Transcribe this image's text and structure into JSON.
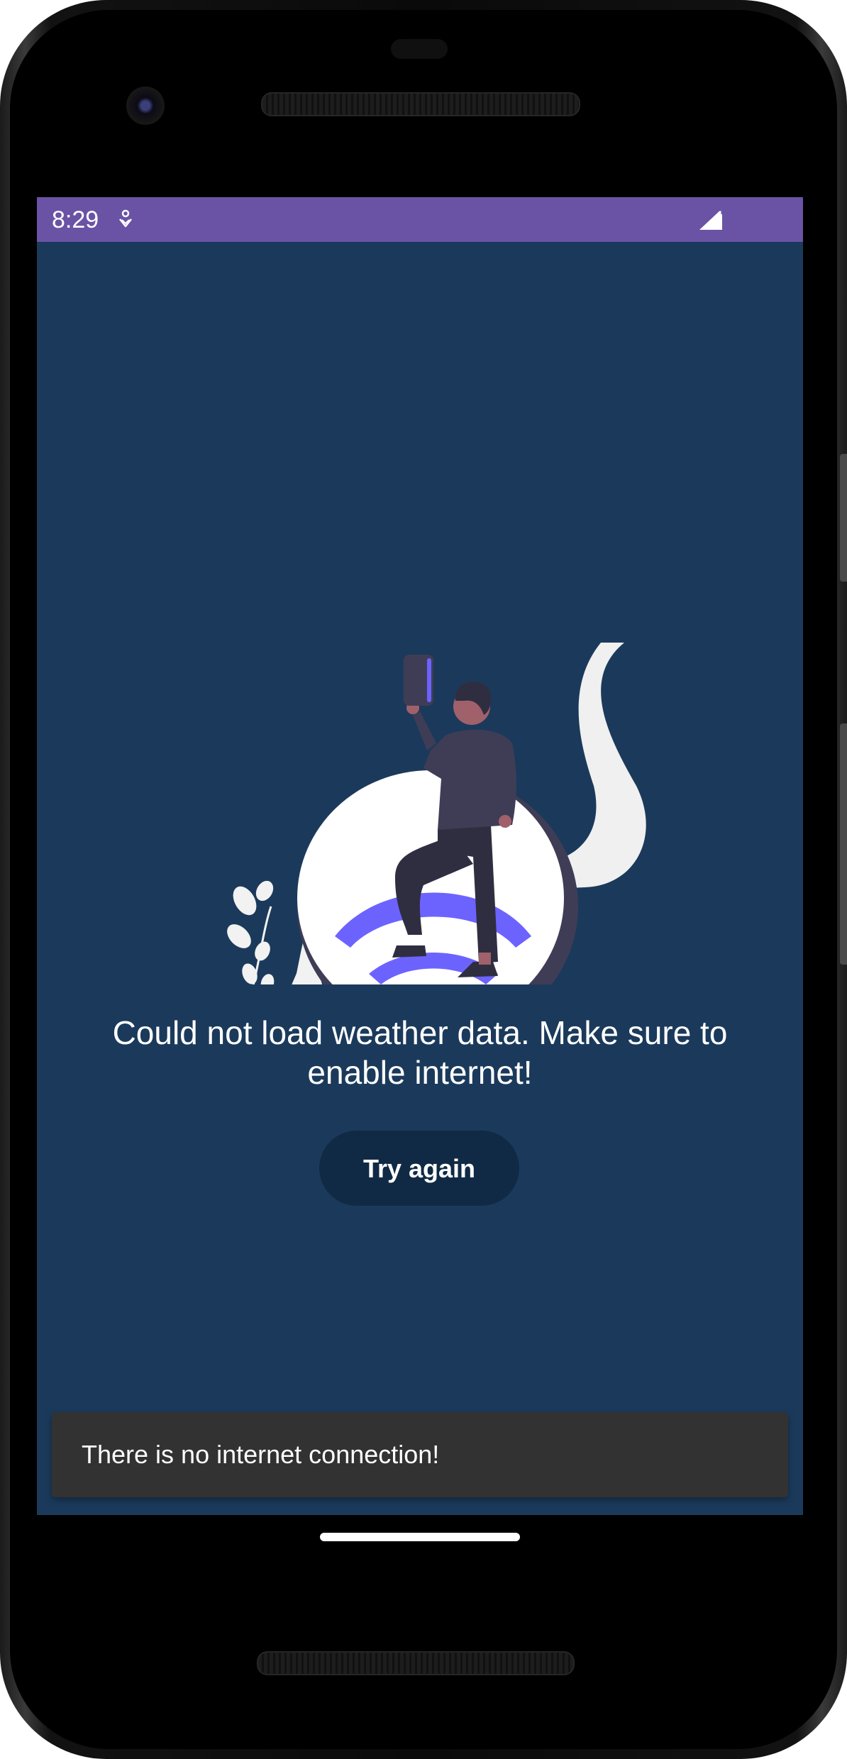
{
  "status_bar": {
    "time": "8:29",
    "assistant_icon": "assistant-person-icon",
    "signal_icon": "cell-signal-icon",
    "color": "#6a53a5"
  },
  "main": {
    "background_color": "#1b3a5b",
    "illustration": "no-internet-illustration",
    "error_message": "Could not load weather data. Make sure to enable internet!",
    "retry_button_label": "Try again"
  },
  "snackbar": {
    "message": "There is no internet connection!"
  },
  "nav": {
    "home_indicator": "gesture-nav-bar"
  }
}
